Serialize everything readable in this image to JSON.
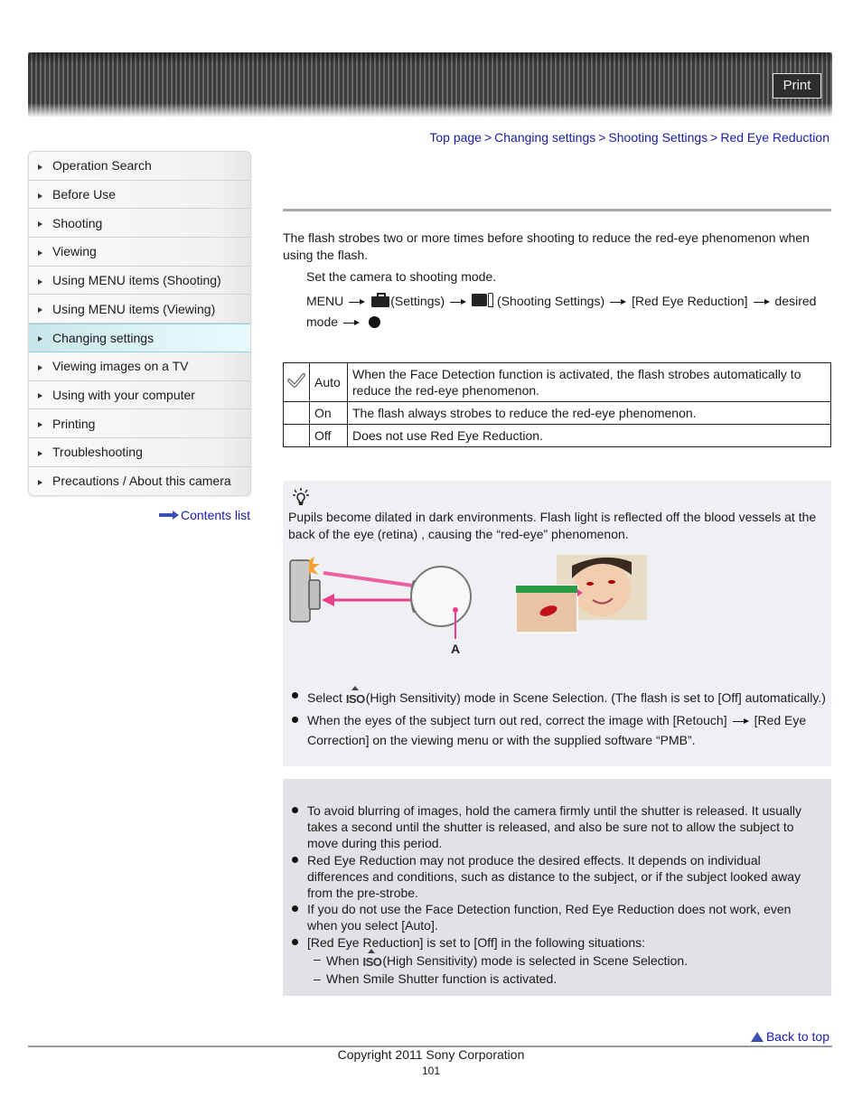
{
  "header": {
    "print_label": "Print"
  },
  "breadcrumb": [
    {
      "label": "Top page"
    },
    {
      "label": "Changing settings"
    },
    {
      "label": "Shooting Settings"
    },
    {
      "label": "Red Eye Reduction"
    }
  ],
  "breadcrumb_separator": ">",
  "sidebar": {
    "items": [
      {
        "label": "Operation Search",
        "active": false
      },
      {
        "label": "Before Use",
        "active": false
      },
      {
        "label": "Shooting",
        "active": false
      },
      {
        "label": "Viewing",
        "active": false
      },
      {
        "label": "Using MENU items (Shooting)",
        "active": false
      },
      {
        "label": "Using MENU items (Viewing)",
        "active": false
      },
      {
        "label": "Changing settings",
        "active": true
      },
      {
        "label": "Viewing images on a TV",
        "active": false
      },
      {
        "label": "Using with your computer",
        "active": false
      },
      {
        "label": "Printing",
        "active": false
      },
      {
        "label": "Troubleshooting",
        "active": false
      },
      {
        "label": "Precautions / About this camera",
        "active": false
      }
    ],
    "contents_link": "Contents list"
  },
  "main": {
    "intro": "The flash strobes two or more times before shooting to reduce the red-eye phenomenon when using the flash.",
    "step1": "Set the camera to shooting mode.",
    "step2": {
      "menu": "MENU",
      "settings": "(Settings)",
      "shooting_settings": "(Shooting Settings)",
      "item": "[Red Eye Reduction]",
      "desired": "desired mode"
    },
    "options": [
      {
        "icon": "checkmark-icon",
        "label": "Auto",
        "description": "When the Face Detection function is activated, the flash strobes automatically to reduce the red-eye phenomenon."
      },
      {
        "icon": "",
        "label": "On",
        "description": "The flash always strobes to reduce the red-eye phenomenon."
      },
      {
        "icon": "",
        "label": "Off",
        "description": "Does not use Red Eye Reduction."
      }
    ],
    "hint": {
      "text": "Pupils become dilated in dark environments. Flash light is reflected off the blood vessels at the back of the eye (retina)       , causing the “red-eye” phenomenon.",
      "diagram_label": "A",
      "tips": [
        {
          "before": "Select",
          "after": "(High Sensitivity) mode in Scene Selection. (The flash is set to [Off] automatically.)"
        },
        {
          "before": "When the eyes of the subject turn out red, correct the image with [Retouch]",
          "after": "[Red Eye Correction] on the viewing menu or with the supplied software “PMB”."
        }
      ],
      "iso_label": "ISO"
    },
    "notes": [
      "To avoid blurring of images, hold the camera firmly until the shutter is released. It usually takes a second until the shutter is released, and also be sure not to allow the subject to move during this period.",
      "Red Eye Reduction may not produce the desired effects. It depends on individual differences and conditions, such as distance to the subject, or if the subject looked away from the pre-strobe.",
      "If you do not use the Face Detection function, Red Eye Reduction does not work, even when you select [Auto].",
      "[Red Eye Reduction] is set to [Off] in the following situations:"
    ],
    "sub_notes": [
      {
        "before": "When",
        "after": "(High Sensitivity) mode is selected in Scene Selection."
      },
      {
        "before": "When Smile Shutter function is activated.",
        "after": ""
      }
    ]
  },
  "footer": {
    "back_to_top": "Back to top",
    "copyright": "Copyright 2011 Sony Corporation",
    "page_number": "101"
  }
}
